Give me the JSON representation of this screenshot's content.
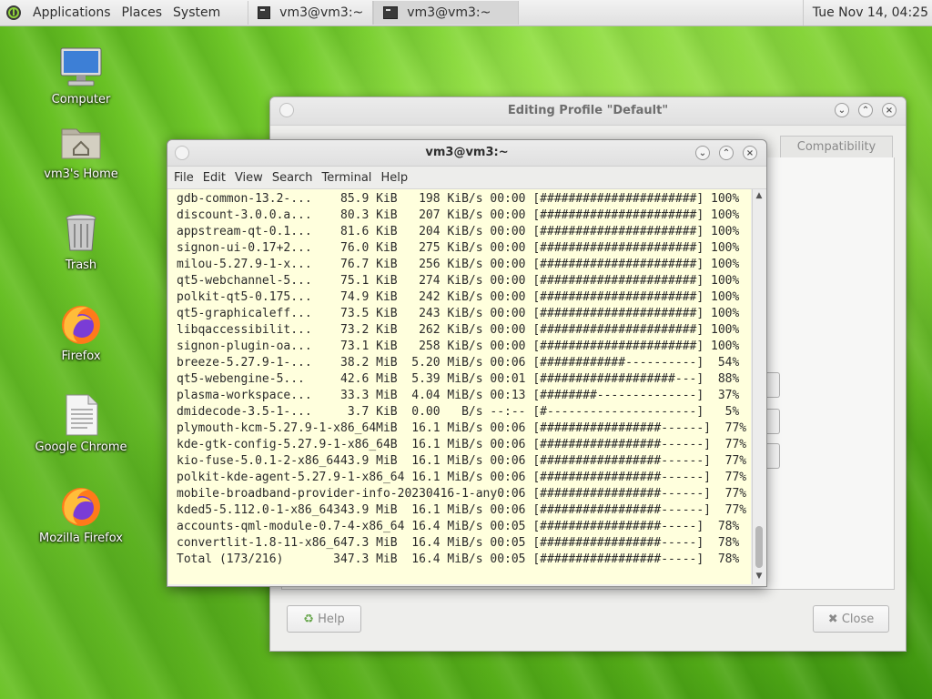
{
  "top_panel": {
    "menus": [
      "Applications",
      "Places",
      "System"
    ],
    "taskbar": [
      {
        "title": "vm3@vm3:~"
      },
      {
        "title": "vm3@vm3:~"
      }
    ],
    "clock": "Tue Nov 14, 04:25"
  },
  "desktop_icons": [
    {
      "label": "Computer",
      "icon": "computer-icon"
    },
    {
      "label": "vm3's Home",
      "icon": "home-folder-icon"
    },
    {
      "label": "Trash",
      "icon": "trash-icon"
    },
    {
      "label": "Firefox",
      "icon": "firefox-icon"
    },
    {
      "label": "Google Chrome",
      "icon": "document-icon"
    },
    {
      "label": "Mozilla Firefox",
      "icon": "firefox-icon"
    }
  ],
  "profile_window": {
    "title": "Editing Profile \"Default\"",
    "tab_visible": "Compatibility",
    "help_button": "Help",
    "close_button": "Close"
  },
  "terminal": {
    "title": "vm3@vm3:~",
    "menu": [
      "File",
      "Edit",
      "View",
      "Search",
      "Terminal",
      "Help"
    ],
    "lines": [
      "gdb-common-13.2-...    85.9 KiB   198 KiB/s 00:00 [######################] 100%",
      "discount-3.0.0.a...    80.3 KiB   207 KiB/s 00:00 [######################] 100%",
      "appstream-qt-0.1...    81.6 KiB   204 KiB/s 00:00 [######################] 100%",
      "signon-ui-0.17+2...    76.0 KiB   275 KiB/s 00:00 [######################] 100%",
      "milou-5.27.9-1-x...    76.7 KiB   256 KiB/s 00:00 [######################] 100%",
      "qt5-webchannel-5...    75.1 KiB   274 KiB/s 00:00 [######################] 100%",
      "polkit-qt5-0.175...    74.9 KiB   242 KiB/s 00:00 [######################] 100%",
      "qt5-graphicaleff...    73.5 KiB   243 KiB/s 00:00 [######################] 100%",
      "libqaccessibilit...    73.2 KiB   262 KiB/s 00:00 [######################] 100%",
      "signon-plugin-oa...    73.1 KiB   258 KiB/s 00:00 [######################] 100%",
      "breeze-5.27.9-1-...    38.2 MiB  5.20 MiB/s 00:06 [############----------]  54%",
      "qt5-webengine-5...     42.6 MiB  5.39 MiB/s 00:01 [###################---]  88%",
      "plasma-workspace...    33.3 MiB  4.04 MiB/s 00:13 [########--------------]  37%",
      "dmidecode-3.5-1-...     3.7 KiB  0.00   B/s --:-- [#---------------------]   5%",
      "plymouth-kcm-5.27.9-1-x86_64MiB  16.1 MiB/s 00:06 [#################------]  77%",
      "kde-gtk-config-5.27.9-1-x86_64B  16.1 MiB/s 00:06 [#################------]  77%",
      "kio-fuse-5.0.1-2-x86_6443.9 MiB  16.1 MiB/s 00:06 [#################------]  77%",
      "polkit-kde-agent-5.27.9-1-x86_64 16.1 MiB/s 00:06 [#################------]  77%",
      "mobile-broadband-provider-info-20230416-1-any0:06 [#################------]  77%",
      "kded5-5.112.0-1-x86_64343.9 MiB  16.1 MiB/s 00:06 [#################------]  77%",
      "accounts-qml-module-0.7-4-x86_64 16.4 MiB/s 00:05 [#################-----]  78%",
      "convertlit-1.8-11-x86_647.3 MiB  16.4 MiB/s 00:05 [#################-----]  78%",
      "Total (173/216)       347.3 MiB  16.4 MiB/s 00:05 [#################-----]  78%"
    ]
  },
  "colors": {
    "terminal_bg": "#ffffdd",
    "desktop_green": "#6cc521"
  }
}
